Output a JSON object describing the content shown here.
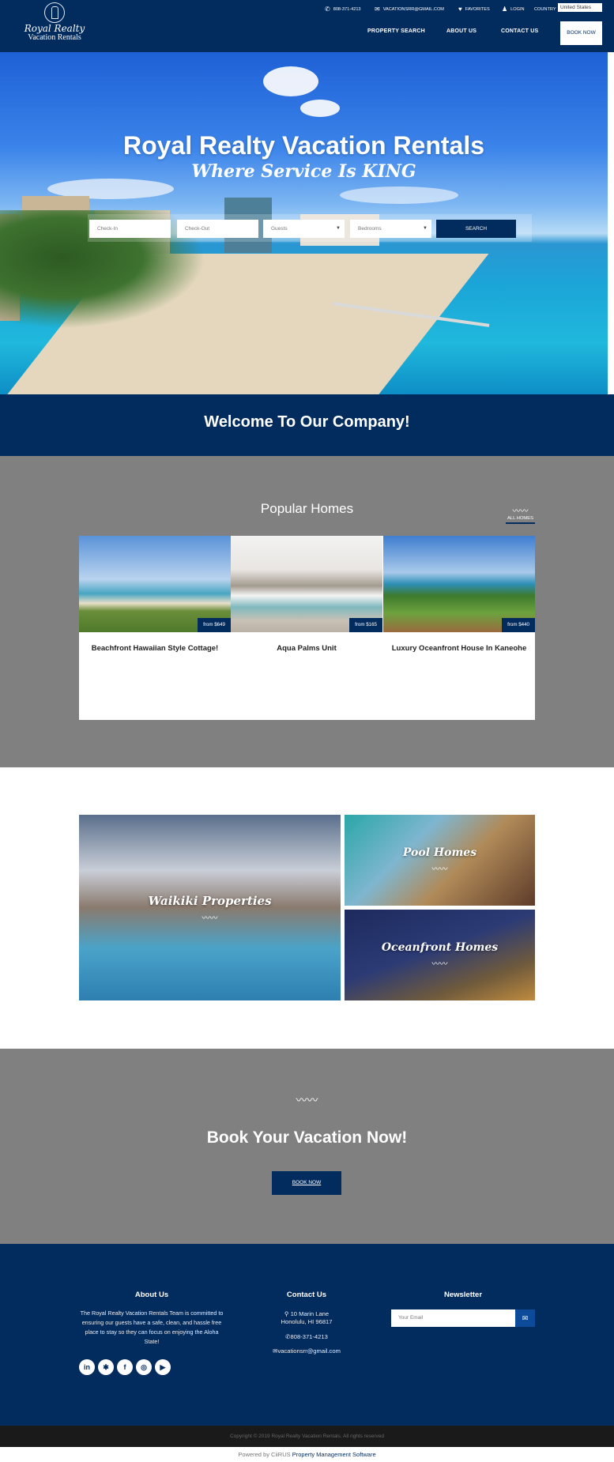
{
  "header": {
    "logo_script": "Royal Realty",
    "logo_sub": "Vacation Rentals",
    "phone": "808-371-4213",
    "email": "VACATIONSRR@GMAIL.COM",
    "favorites": "FAVORITES",
    "login": "LOGIN",
    "country_label": "COUNTRY",
    "country_value": "United States",
    "nav": [
      "PROPERTY SEARCH",
      "ABOUT US",
      "CONTACT US"
    ],
    "book_now": "BOOK NOW"
  },
  "hero": {
    "title": "Royal Realty Vacation Rentals",
    "tagline": "Where Service Is KING",
    "search": {
      "checkin_placeholder": "Check-In",
      "checkout_placeholder": "Check-Out",
      "guests_value": "Guests",
      "bedrooms_value": "Bedrooms",
      "button": "SEARCH"
    }
  },
  "welcome": {
    "title": "Welcome To Our Company!"
  },
  "popular": {
    "title": "Popular Homes",
    "all_homes": "ALL HOMES",
    "homes": [
      {
        "name": "Beachfront Hawaiian Style Cottage!",
        "price": "from $649"
      },
      {
        "name": "Aqua Palms Unit",
        "price": "from $165"
      },
      {
        "name": "Luxury Oceanfront House In Kaneohe",
        "price": "from $440"
      }
    ]
  },
  "categories": [
    {
      "label": "Waikiki Properties"
    },
    {
      "label": "Pool Homes"
    },
    {
      "label": "Oceanfront Homes"
    }
  ],
  "book": {
    "title": "Book Your Vacation Now!",
    "button": "BOOK NOW"
  },
  "footer": {
    "about_title": "About Us",
    "about_text": "The Royal Realty Vacation Rentals Team is committed to ensuring our guests have a safe, clean, and hassle free place to stay so they can focus on enjoying the Aloha State!",
    "contact_title": "Contact Us",
    "address_line1": "10 Marin Lane",
    "address_line2": "Honolulu, HI 96817",
    "phone": "808-371-4213",
    "email": "vacationsrr@gmail.com",
    "newsletter_title": "Newsletter",
    "newsletter_placeholder": "Your Email",
    "social_icons": [
      "linkedin-icon",
      "yelp-icon",
      "facebook-icon",
      "instagram-icon",
      "youtube-icon"
    ]
  },
  "bottom": {
    "copyright": "Copyright © 2019 Royal Realty Vacation Rentals. All rights reserved",
    "powered_prefix": "Powered by CiiRUS",
    "powered_link": "Property Management Software"
  },
  "colors": {
    "navy": "#022b5e",
    "gray": "#808080",
    "dark": "#1a1a1a"
  }
}
